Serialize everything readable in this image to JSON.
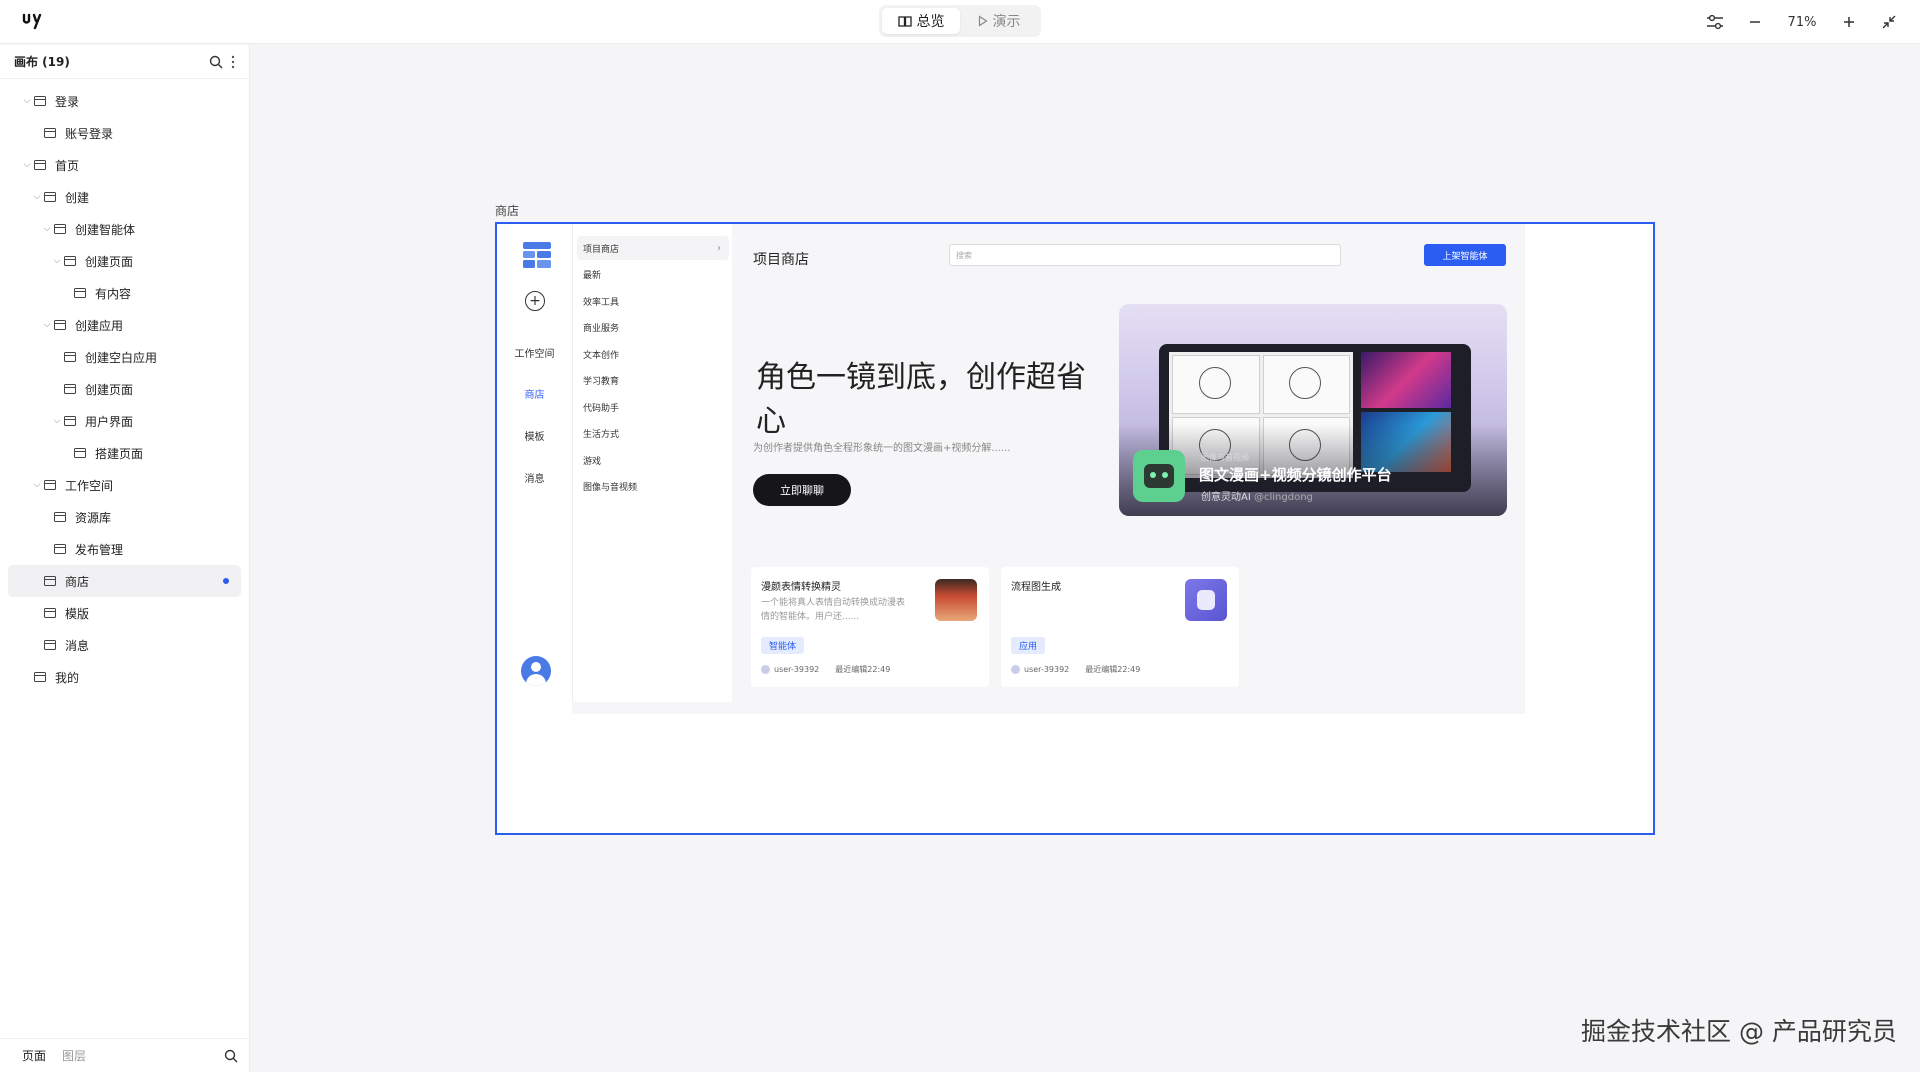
{
  "topbar": {
    "modes": [
      {
        "label": "总览"
      },
      {
        "label": "演示"
      }
    ],
    "zoom": "71%"
  },
  "sidebar": {
    "title": "画布 (19)",
    "items": [
      {
        "label": "登录",
        "level": 0,
        "expanded": true
      },
      {
        "label": "账号登录",
        "level": 1
      },
      {
        "label": "首页",
        "level": 0,
        "expanded": true
      },
      {
        "label": "创建",
        "level": 1,
        "expanded": true
      },
      {
        "label": "创建智能体",
        "level": 2,
        "expanded": true
      },
      {
        "label": "创建页面",
        "level": 3,
        "expanded": true
      },
      {
        "label": "有内容",
        "level": 4
      },
      {
        "label": "创建应用",
        "level": 2,
        "expanded": true
      },
      {
        "label": "创建空白应用",
        "level": 3
      },
      {
        "label": "创建页面",
        "level": 3
      },
      {
        "label": "用户界面",
        "level": 3,
        "expanded": true
      },
      {
        "label": "搭建页面",
        "level": 4
      },
      {
        "label": "工作空间",
        "level": 1,
        "expanded": true
      },
      {
        "label": "资源库",
        "level": 2
      },
      {
        "label": "发布管理",
        "level": 2
      },
      {
        "label": "商店",
        "level": 1,
        "selected": true
      },
      {
        "label": "模版",
        "level": 1
      },
      {
        "label": "消息",
        "level": 1
      },
      {
        "label": "我的",
        "level": 0
      }
    ],
    "footer": {
      "tab_pages": "页面",
      "tab_layers": "图层"
    }
  },
  "canvas": {
    "frame_label": "商店",
    "app": {
      "nav": {
        "workspace": "工作空间",
        "store": "商店",
        "template": "模板",
        "message": "消息"
      },
      "categories": [
        "项目商店",
        "最新",
        "效率工具",
        "商业服务",
        "文本创作",
        "学习教育",
        "代码助手",
        "生活方式",
        "游戏",
        "图像与音视频"
      ],
      "title": "项目商店",
      "search_placeholder": "搜索",
      "publish_button": "上架智能体",
      "hero": {
        "title": "角色一镜到底，创作超省心",
        "subtitle": "为创作者提供角色全程形象统一的图文漫画+视频分解......",
        "button": "立即聊聊"
      },
      "banner": {
        "small": "图像与音视频",
        "title": "图文漫画+视频分镜创作平台",
        "author": "创意灵动AI",
        "handle": "@clingdong"
      },
      "cards": [
        {
          "title": "漫颜表情转换精灵",
          "desc": "一个能将真人表情自动转换成动漫表情的智能体。用户还......",
          "tag": "智能体",
          "user": "user-39392",
          "time": "最近编辑22:49"
        },
        {
          "title": "流程图生成",
          "desc": "",
          "tag": "应用",
          "user": "user-39392",
          "time": "最近编辑22:49"
        }
      ]
    }
  },
  "watermark": "掘金技术社区 @ 产品研究员"
}
